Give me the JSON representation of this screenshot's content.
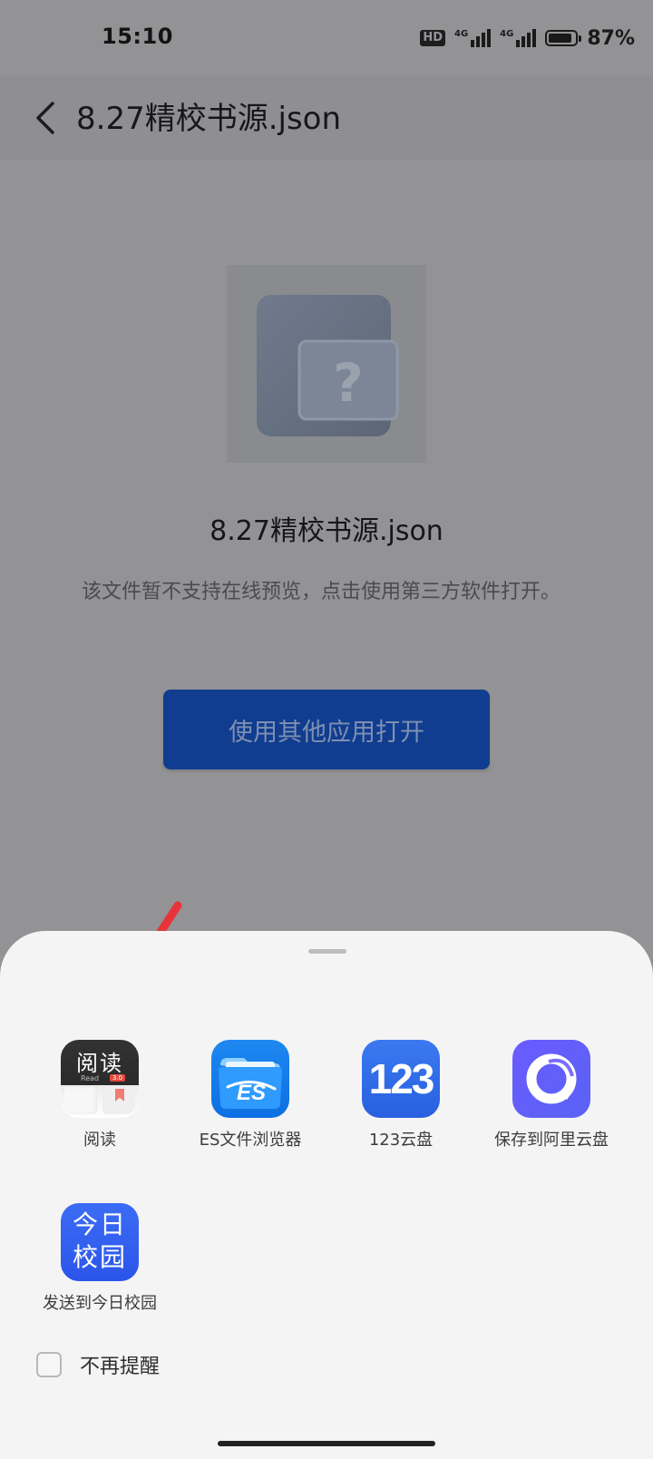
{
  "status_bar": {
    "time": "15:10",
    "hd_label": "HD",
    "signal_1": "4G",
    "signal_2": "4G",
    "battery_level": 0.87,
    "battery_text": "87%"
  },
  "app_bar": {
    "title": "8.27精校书源.json",
    "back_icon": "chevron-left-icon"
  },
  "preview": {
    "file_icon": "unknown-file-icon",
    "file_name": "8.27精校书源.json",
    "hint": "该文件暂不支持在线预览，点击使用第三方软件打开。",
    "open_button": "使用其他应用打开"
  },
  "share_sheet": {
    "apps": [
      {
        "label": "阅读",
        "icon_title": "阅读",
        "icon_sub": "Read",
        "icon_badge": "3.0"
      },
      {
        "label": "ES文件浏览器",
        "icon_text": "ES"
      },
      {
        "label": "123云盘",
        "icon_text": "123"
      },
      {
        "label": "保存到阿里云盘"
      },
      {
        "label": "发送到今日校园",
        "icon_text": "今日校园"
      }
    ],
    "dont_remind": "不再提醒",
    "dont_remind_checked": false
  },
  "colors": {
    "accent_button": "#103d8f",
    "arrow": "#e8333b",
    "sheet_bg": "#f4f4f4"
  }
}
